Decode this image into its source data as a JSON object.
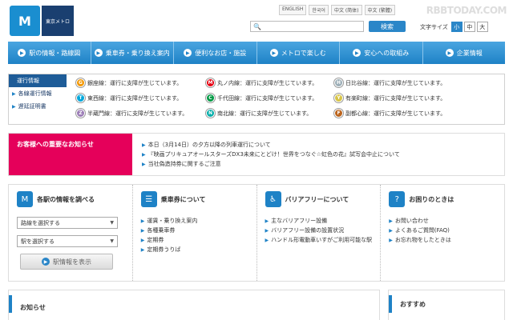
{
  "header": {
    "logo_text": "東京メトロ",
    "languages": [
      "ENGLISH",
      "한국어",
      "中文 (简体)",
      "中文 (繁體)"
    ],
    "watermark": "RBBTODAY.COM",
    "search_placeholder": "",
    "search_button": "検索",
    "font_size_label": "文字サイズ",
    "font_sizes": [
      "小",
      "中",
      "大"
    ]
  },
  "nav": [
    "駅の情報・路線図",
    "乗車券・乗り換え案内",
    "便利なお店・施設",
    "メトロで楽しむ",
    "安心への取組み",
    "企業情報"
  ],
  "operations": {
    "heading": "運行情報",
    "links": [
      "各線運行情報",
      "遅延証明書"
    ],
    "lines": [
      {
        "code": "G",
        "text": "銀座線：運行に支障が生じています。",
        "color": "#f39700"
      },
      {
        "code": "M",
        "text": "丸ノ内線：運行に支障が生じています。",
        "color": "#e60012"
      },
      {
        "code": "H",
        "text": "日比谷線：運行に支障が生じています。",
        "color": "#9caeb7"
      },
      {
        "code": "T",
        "text": "東西線：運行に支障が生じています。",
        "color": "#00a7db"
      },
      {
        "code": "C",
        "text": "千代田線：運行に支障が生じています。",
        "color": "#009944"
      },
      {
        "code": "Y",
        "text": "有楽町線：運行に支障が生じています。",
        "color": "#d7c447"
      },
      {
        "code": "Z",
        "text": "半蔵門線：運行に支障が生じています。",
        "color": "#9b7cb6"
      },
      {
        "code": "N",
        "text": "南北線：運行に支障が生じています。",
        "color": "#00ada9"
      },
      {
        "code": "F",
        "text": "副都心線：運行に支障が生じています。",
        "color": "#bb641d"
      }
    ]
  },
  "notice": {
    "heading": "お客様への重要なお知らせ",
    "items": [
      "本日（3月14日）の夕方以降の列車運行について",
      "『映画プリキュアオールスターズDX3未来にとどけ！世界をつなぐ☆虹色の花』試写会中止について",
      "当社偽造持券に関するご注意"
    ]
  },
  "boxes": {
    "station": {
      "title": "各駅の情報を調べる",
      "line_select": "路線を選択する",
      "station_select": "駅を選択する",
      "button": "駅情報を表示"
    },
    "tickets": {
      "title": "乗車券について",
      "links": [
        "運賃・乗り換え案内",
        "各種乗車券",
        "定期券",
        "定期券うりば"
      ]
    },
    "barrier": {
      "title": "バリアフリーについて",
      "links": [
        "主なバリアフリー設備",
        "バリアフリー設備の設置状況",
        "ハンドル形電動車いすがご利用可能な駅"
      ]
    },
    "help": {
      "title": "お困りのときは",
      "links": [
        "お問い合わせ",
        "よくあるご質問(FAQ)",
        "お忘れ物をしたときは"
      ]
    }
  },
  "bottom": {
    "news_title": "お知らせ",
    "recommend_title": "おすすめ"
  }
}
